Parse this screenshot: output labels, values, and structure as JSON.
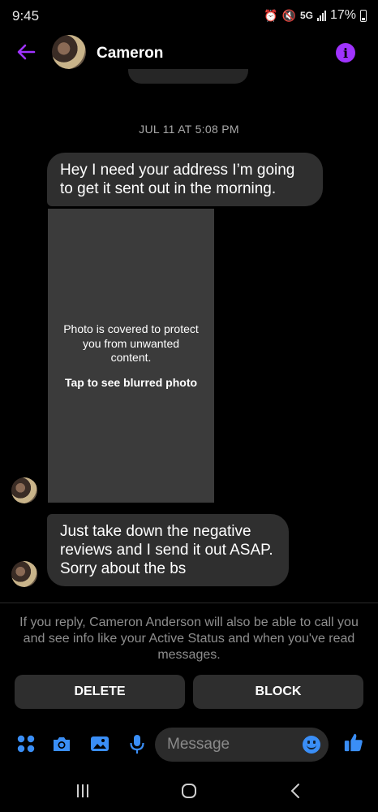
{
  "status_bar": {
    "time": "9:45",
    "network": "5G",
    "battery": "17%"
  },
  "header": {
    "contact_name": "Cameron",
    "info_glyph": "i"
  },
  "conversation": {
    "timestamp": "JUL 11 AT 5:08 PM",
    "messages": [
      {
        "text": "Hey I need your address I’m going to get it sent out in the morning."
      },
      {
        "text": "Just take down the negative reviews and I send it out ASAP. Sorry about the bs"
      }
    ],
    "photo": {
      "note": "Photo is covered to protect you from unwanted content.",
      "tap_label": "Tap to see blurred photo"
    }
  },
  "request": {
    "notice": "If you reply, Cameron Anderson will also be able to call you and see info like your Active Status and when you've read messages.",
    "delete_label": "DELETE",
    "block_label": "BLOCK"
  },
  "composer": {
    "placeholder": "Message"
  },
  "colors": {
    "accent": "#a033ff",
    "composer_blue": "#3a8ef6",
    "bubble": "#2f2f2f"
  },
  "icons": [
    "back-arrow-icon",
    "info-icon",
    "menu-icon",
    "camera-icon",
    "gallery-icon",
    "mic-icon",
    "emoji-icon",
    "like-icon",
    "recent-apps-icon",
    "home-icon",
    "nav-back-icon"
  ]
}
